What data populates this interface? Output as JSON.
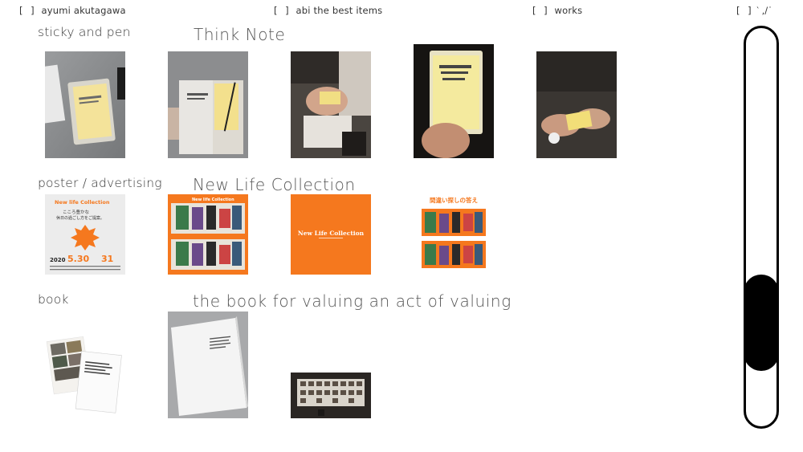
{
  "nav": {
    "items": [
      {
        "bracket": "[ ]",
        "label": "ayumi akutagawa"
      },
      {
        "bracket": "[ ]",
        "label": "abi the best items"
      },
      {
        "bracket": "[ ]",
        "label": "works"
      },
      {
        "bracket": "[ ]",
        "label": "‵ ,/˙"
      }
    ]
  },
  "sections": [
    {
      "label": "sticky and pen",
      "title": "Think Note"
    },
    {
      "label": "poster / advertising",
      "title": "New Life Collection"
    },
    {
      "label": "book",
      "title": "the book for valuing an act of valuing"
    }
  ],
  "poster": {
    "brand": "New Life Collection",
    "jp_line1": "こころ豊かな",
    "jp_line2": "休日の過ごし方をご提案。",
    "date_a": "2020",
    "date_b": "5.30",
    "date_c": "31",
    "puzzle_title": "間違い探しの答え"
  },
  "book_cover_text": "the book for valuing an act of valuing",
  "slider": {
    "position": 0.62
  },
  "colors": {
    "accent_orange": "#f5781e",
    "bg": "#ffffff",
    "slider": "#000000"
  }
}
